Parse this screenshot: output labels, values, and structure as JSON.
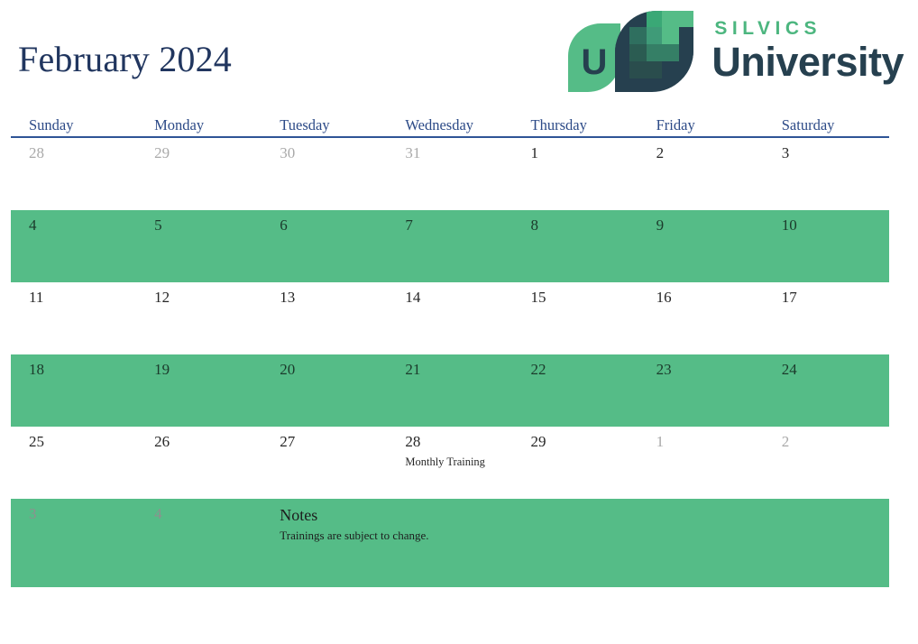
{
  "header": {
    "month_title": "February 2024"
  },
  "logo": {
    "mark_name": "silvics-leaf-u-mark",
    "mark_letter": "U",
    "silvics": "SILVICS",
    "university": "University",
    "colors": {
      "green": "#4cb67f",
      "light_green": "#55bc87",
      "dark_teal": "#26404f",
      "mid_teal": "#2f5f5a"
    }
  },
  "calendar": {
    "weekdays": [
      "Sunday",
      "Monday",
      "Tuesday",
      "Wednesday",
      "Thursday",
      "Friday",
      "Saturday"
    ],
    "accent_navy": "#2f5496",
    "shade_green": "#55bc87",
    "weeks": [
      {
        "shaded": false,
        "days": [
          {
            "num": "28",
            "muted": true,
            "event": ""
          },
          {
            "num": "29",
            "muted": true,
            "event": ""
          },
          {
            "num": "30",
            "muted": true,
            "event": ""
          },
          {
            "num": "31",
            "muted": true,
            "event": ""
          },
          {
            "num": "1",
            "muted": false,
            "event": ""
          },
          {
            "num": "2",
            "muted": false,
            "event": ""
          },
          {
            "num": "3",
            "muted": false,
            "event": ""
          }
        ]
      },
      {
        "shaded": true,
        "days": [
          {
            "num": "4",
            "muted": false,
            "event": ""
          },
          {
            "num": "5",
            "muted": false,
            "event": ""
          },
          {
            "num": "6",
            "muted": false,
            "event": ""
          },
          {
            "num": "7",
            "muted": false,
            "event": ""
          },
          {
            "num": "8",
            "muted": false,
            "event": ""
          },
          {
            "num": "9",
            "muted": false,
            "event": ""
          },
          {
            "num": "10",
            "muted": false,
            "event": ""
          }
        ]
      },
      {
        "shaded": false,
        "days": [
          {
            "num": "11",
            "muted": false,
            "event": ""
          },
          {
            "num": "12",
            "muted": false,
            "event": ""
          },
          {
            "num": "13",
            "muted": false,
            "event": ""
          },
          {
            "num": "14",
            "muted": false,
            "event": ""
          },
          {
            "num": "15",
            "muted": false,
            "event": ""
          },
          {
            "num": "16",
            "muted": false,
            "event": ""
          },
          {
            "num": "17",
            "muted": false,
            "event": ""
          }
        ]
      },
      {
        "shaded": true,
        "days": [
          {
            "num": "18",
            "muted": false,
            "event": ""
          },
          {
            "num": "19",
            "muted": false,
            "event": ""
          },
          {
            "num": "20",
            "muted": false,
            "event": ""
          },
          {
            "num": "21",
            "muted": false,
            "event": ""
          },
          {
            "num": "22",
            "muted": false,
            "event": ""
          },
          {
            "num": "23",
            "muted": false,
            "event": ""
          },
          {
            "num": "24",
            "muted": false,
            "event": ""
          }
        ]
      },
      {
        "shaded": false,
        "days": [
          {
            "num": "25",
            "muted": false,
            "event": ""
          },
          {
            "num": "26",
            "muted": false,
            "event": ""
          },
          {
            "num": "27",
            "muted": false,
            "event": ""
          },
          {
            "num": "28",
            "muted": false,
            "event": "Monthly Training"
          },
          {
            "num": "29",
            "muted": false,
            "event": ""
          },
          {
            "num": "1",
            "muted": true,
            "event": ""
          },
          {
            "num": "2",
            "muted": true,
            "event": ""
          }
        ]
      }
    ],
    "notes_row": {
      "shaded": true,
      "days": [
        {
          "num": "3",
          "muted": true
        },
        {
          "num": "4",
          "muted": true
        }
      ],
      "notes_title": "Notes",
      "notes_body": "Trainings are subject to change."
    }
  }
}
